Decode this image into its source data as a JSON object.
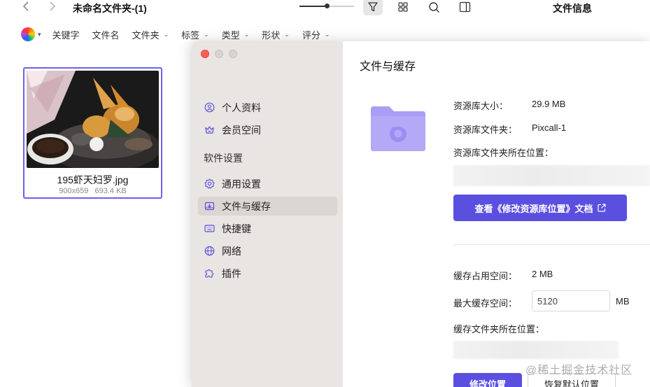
{
  "toolbar": {
    "back_icon": "chevron-left-icon",
    "forward_icon": "chevron-right-icon",
    "title": "未命名文件夹-(1)",
    "zoom_level": 0.5,
    "icons": [
      "filter-icon",
      "grid-icon",
      "search-icon",
      "sidebar-toggle-icon"
    ],
    "file_info_label": "文件信息"
  },
  "filterbar": {
    "color_filter": "color-wheel-icon",
    "items": [
      {
        "label": "关键字",
        "dropdown": false
      },
      {
        "label": "文件名",
        "dropdown": false
      },
      {
        "label": "文件夹",
        "dropdown": true
      },
      {
        "label": "标签",
        "dropdown": true
      },
      {
        "label": "类型",
        "dropdown": true
      },
      {
        "label": "形状",
        "dropdown": true
      },
      {
        "label": "评分",
        "dropdown": true
      }
    ]
  },
  "file_card": {
    "name": "195虾天妇罗.jpg",
    "dimensions": "900x659",
    "size": "693.4 KB",
    "selected": true
  },
  "settings_window": {
    "sidebar": {
      "account_items": [
        {
          "label": "个人资料",
          "icon": "user-circle-icon"
        },
        {
          "label": "会员空间",
          "icon": "crown-icon"
        }
      ],
      "section_label": "软件设置",
      "settings_items": [
        {
          "label": "通用设置",
          "icon": "gear-icon",
          "active": false
        },
        {
          "label": "文件与缓存",
          "icon": "download-tray-icon",
          "active": true
        },
        {
          "label": "快捷键",
          "icon": "keyboard-icon",
          "active": false
        },
        {
          "label": "网络",
          "icon": "globe-icon",
          "active": false
        },
        {
          "label": "插件",
          "icon": "puzzle-icon",
          "active": false
        }
      ]
    },
    "main": {
      "title": "文件与缓存",
      "library_size_label": "资源库大小：",
      "library_size_value": "29.9 MB",
      "library_folder_label": "资源库文件夹：",
      "library_folder_value": "Pixcall-1",
      "library_location_label": "资源库文件夹所在位置：",
      "docs_button_label": "查看《修改资源库位置》文档",
      "cache_used_label": "缓存占用空间：",
      "cache_used_value": "2 MB",
      "max_cache_label": "最大缓存空间：",
      "max_cache_value": "5120",
      "max_cache_unit": "MB",
      "cache_location_label": "缓存文件夹所在位置：",
      "change_location_button": "修改位置",
      "restore_default_button": "恢复默认位置"
    }
  },
  "watermark": "@稀土掘金技术社区",
  "colors": {
    "accent": "#5b4fe0",
    "selection_border": "#6b62e8",
    "sidebar_bg": "#e9e5e3",
    "folder": "#a99ef5"
  }
}
